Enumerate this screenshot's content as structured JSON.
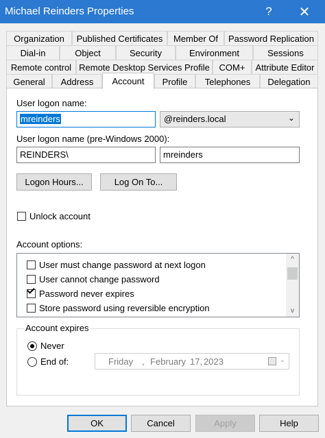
{
  "window": {
    "title": "Michael Reinders Properties",
    "help_glyph": "?",
    "close_glyph": "✕"
  },
  "tabs": {
    "row1": [
      "Organization",
      "Published Certificates",
      "Member Of",
      "Password Replication"
    ],
    "row2": [
      "Dial-in",
      "Object",
      "Security",
      "Environment",
      "Sessions"
    ],
    "row3": [
      "Remote control",
      "Remote Desktop Services Profile",
      "COM+",
      "Attribute Editor"
    ],
    "row4": [
      "General",
      "Address",
      "Account",
      "Profile",
      "Telephones",
      "Delegation"
    ],
    "active": "Account"
  },
  "account": {
    "logon_name_label": "User logon name:",
    "logon_name_value": "mreinders",
    "domain_value": "@reinders.local",
    "pre2000_label": "User logon name (pre-Windows 2000):",
    "pre2000_domain": "REINDERS\\",
    "pre2000_name": "mreinders",
    "logon_hours_button": "Logon Hours...",
    "log_on_to_button": "Log On To...",
    "unlock_label": "Unlock account",
    "unlock_checked": false,
    "options_label": "Account options:",
    "options": [
      {
        "label": "User must change password at next logon",
        "checked": false
      },
      {
        "label": "User cannot change password",
        "checked": false
      },
      {
        "label": "Password never expires",
        "checked": true
      },
      {
        "label": "Store password using reversible encryption",
        "checked": false
      }
    ],
    "expires_group_label": "Account expires",
    "never_label": "Never",
    "never_selected": true,
    "end_of_label": "End of:",
    "date": {
      "weekday": "Friday",
      "sep": ",",
      "month": "February",
      "day": "17,",
      "year": "2023"
    }
  },
  "buttons": {
    "ok": "OK",
    "cancel": "Cancel",
    "apply": "Apply",
    "help": "Help"
  },
  "icons": {
    "scroll_up": "^",
    "scroll_down": "v",
    "dropdown": "⌄"
  }
}
